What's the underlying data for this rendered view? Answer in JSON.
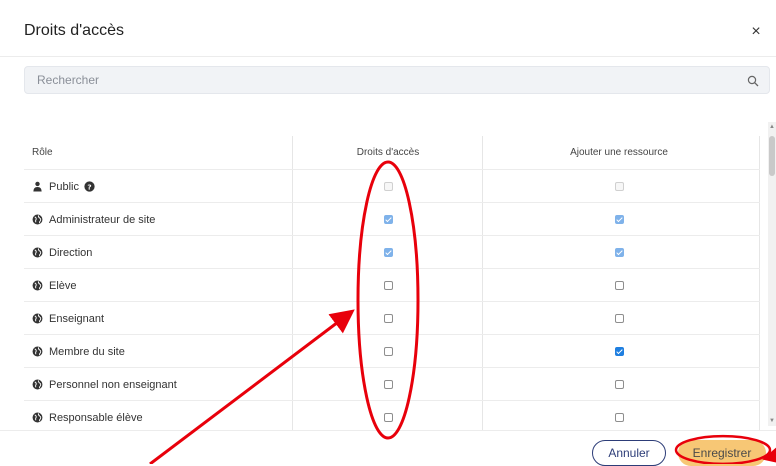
{
  "dialog": {
    "title": "Droits d'accès",
    "close_glyph": "×"
  },
  "search": {
    "placeholder": "Rechercher"
  },
  "table": {
    "headers": {
      "role": "Rôle",
      "access": "Droits d'accès",
      "add_resource": "Ajouter une ressource"
    },
    "rows": [
      {
        "label": "Public",
        "icon": "person-icon",
        "help": true,
        "access": false,
        "add_resource": false,
        "disabled": true
      },
      {
        "label": "Administrateur de site",
        "icon": "globe-icon",
        "access": true,
        "add_resource": true,
        "muted": true
      },
      {
        "label": "Direction",
        "icon": "globe-icon",
        "access": true,
        "add_resource": true,
        "muted": true
      },
      {
        "label": "Elève",
        "icon": "globe-icon",
        "access": false,
        "add_resource": false
      },
      {
        "label": "Enseignant",
        "icon": "globe-icon",
        "access": false,
        "add_resource": false
      },
      {
        "label": "Membre du site",
        "icon": "globe-icon",
        "access": false,
        "add_resource": true
      },
      {
        "label": "Personnel non enseignant",
        "icon": "globe-icon",
        "access": false,
        "add_resource": false
      },
      {
        "label": "Responsable élève",
        "icon": "globe-icon",
        "access": false,
        "add_resource": false
      }
    ]
  },
  "footer": {
    "cancel_label": "Annuler",
    "save_label": "Enregistrer"
  },
  "colors": {
    "checked": "#1f7fe0",
    "cancel_border": "#2d3d78",
    "save_bg": "#f7c775",
    "annotation": "#e8000b"
  }
}
